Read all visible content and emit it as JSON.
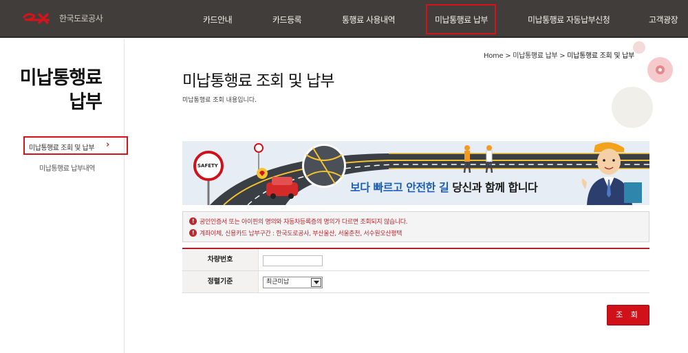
{
  "header": {
    "logo_text": "한국도로공사",
    "nav": [
      "카드안내",
      "카드등록",
      "통행료 사용내역",
      "미납통행료 납부",
      "미납통행료 자동납부신청",
      "고객광장"
    ],
    "active_nav": "미납통행료 납부"
  },
  "sidebar": {
    "title_line1": "미납통행료",
    "title_line2": "납부",
    "items": [
      {
        "label": "미납통행료 조회 및 납부",
        "active": true
      },
      {
        "label": "미납통행료 납부내역",
        "active": false
      }
    ]
  },
  "breadcrumb": {
    "home": "Home",
    "level1": "미납통행료 납부",
    "current": "미납통행료 조회 및 납부",
    "separator": ">"
  },
  "main": {
    "title": "미납통행료 조회 및 납부",
    "subtitle": "미납통행료 조회 내용입니다."
  },
  "banner": {
    "safety_sign": "SAFETY",
    "text_blue": "보다 빠르고 안전한 길",
    "text_black": "당신과 함께 합니다"
  },
  "notice": {
    "lines": [
      "공인인증서 또는 아이핀의 명의와 자동차등록증의 명의가 다르면 조회되지 않습니다.",
      "계좌이체, 신용카드 납부구간 : 한국도로공사, 부산울산, 서울춘천, 서수원오산평택"
    ]
  },
  "form": {
    "car_number_label": "차량번호",
    "car_number_value": "",
    "sort_label": "정렬기준",
    "sort_selected": "최근미납"
  },
  "search_button": "조 회",
  "colors": {
    "brand_red": "#d0111a",
    "header_bg": "#403d3a",
    "notice_red": "#c0272d",
    "banner_blue": "#1c5fb5"
  }
}
